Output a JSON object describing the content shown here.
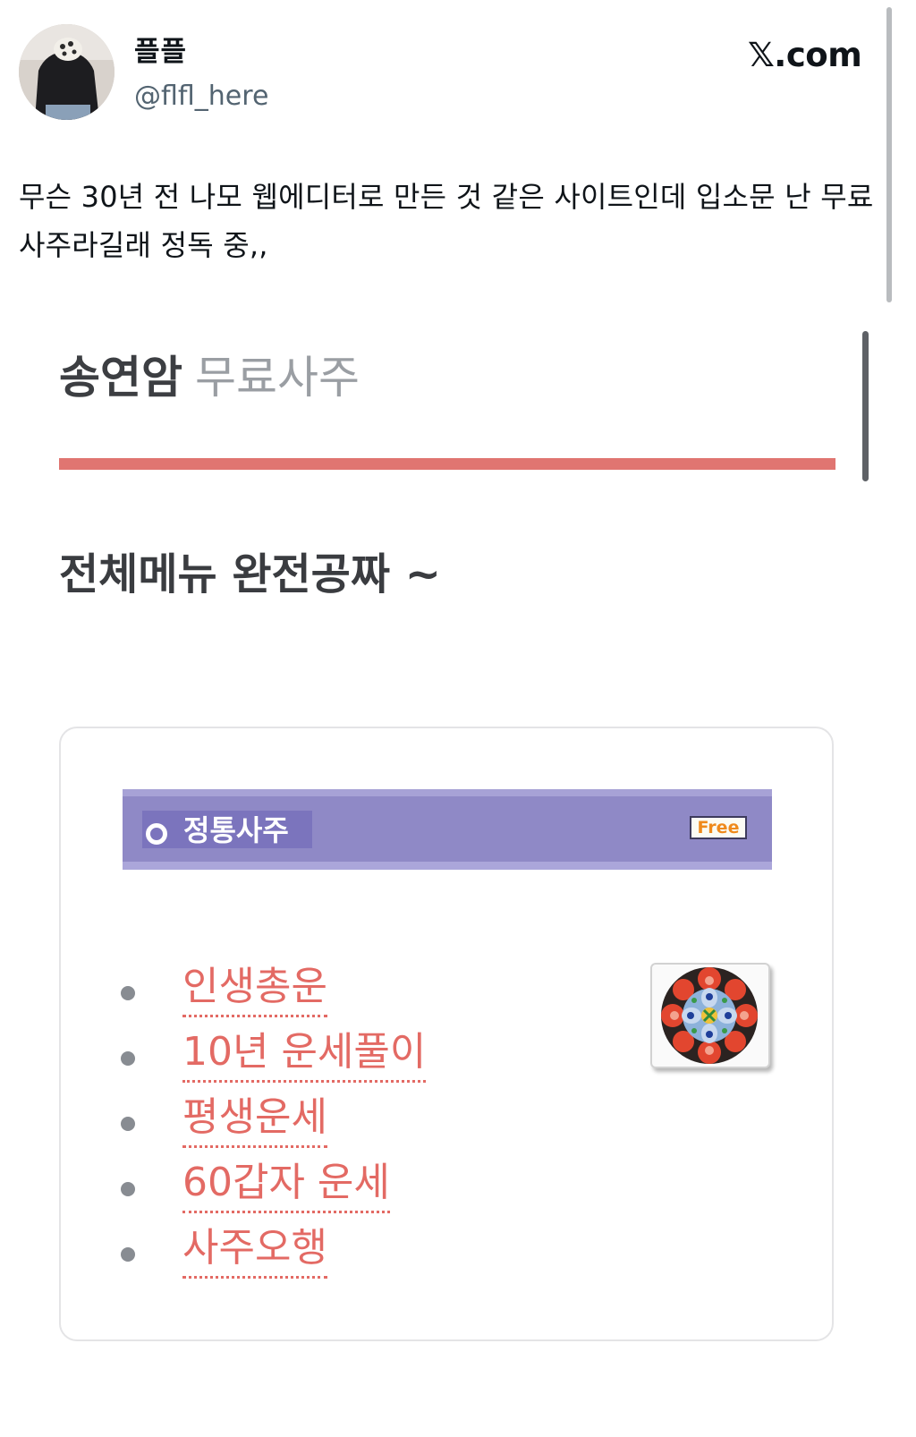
{
  "tweet": {
    "author": {
      "display_name": "플플",
      "handle": "@flfl_here"
    },
    "brand": "𝕏.com",
    "text": "무슨 30년 전 나모 웹에디터로 만든 것 같은 사이트인데 입소문 난 무료 사주라길래 정독 중,,"
  },
  "site": {
    "title_strong": "송연암",
    "title_light": "무료사주",
    "accent_color": "#e07571",
    "headline": "전체메뉴 완전공짜 ~",
    "menu_card": {
      "banner_label": "정통사주",
      "banner_badge": "Free",
      "banner_color": "#8f89c6",
      "items": [
        {
          "label": "인생총운"
        },
        {
          "label": "10년 운세풀이"
        },
        {
          "label": "평생운세"
        },
        {
          "label": "60갑자 운세"
        },
        {
          "label": "사주오행"
        }
      ],
      "link_color": "#e36a64",
      "emblem_icon": "dancheong-flower-emblem"
    }
  }
}
